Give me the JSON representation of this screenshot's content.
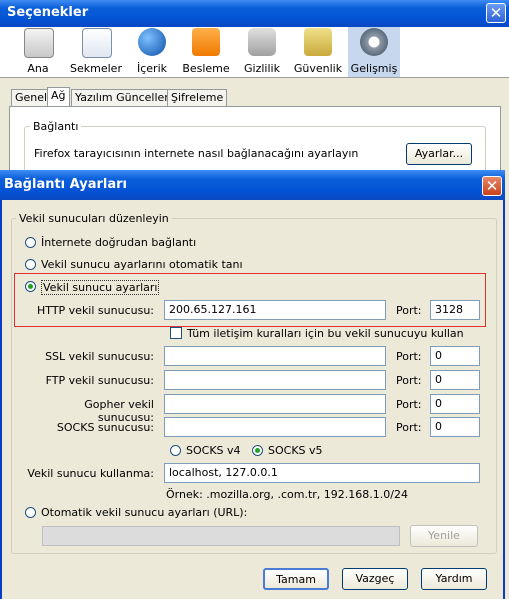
{
  "background_window": {
    "title": "Seçenekler",
    "toolbar": [
      {
        "label": "Ana",
        "icon": "main-icon"
      },
      {
        "label": "Sekmeler",
        "icon": "tabs-icon"
      },
      {
        "label": "İçerik",
        "icon": "content-globe-icon"
      },
      {
        "label": "Besleme",
        "icon": "feed-icon"
      },
      {
        "label": "Gizlilik",
        "icon": "privacy-icon"
      },
      {
        "label": "Güvenlik",
        "icon": "security-lock-icon"
      },
      {
        "label": "Gelişmiş",
        "icon": "advanced-gear-icon"
      }
    ],
    "tabs": [
      "Genel",
      "Ağ",
      "Yazılım Güncelleme",
      "Şifreleme"
    ],
    "group_label": "Bağlantı",
    "description": "Firefox tarayıcısının internete nasıl bağlanacağını ayarlayın",
    "settings_button": "Ayarlar..."
  },
  "dialog": {
    "title": "Bağlantı Ayarları",
    "group_label": "Vekil sunucuları düzenleyin",
    "options": {
      "direct": "İnternete doğrudan bağlantı",
      "auto_detect": "Vekil sunucu ayarlarını otomatik tanı",
      "manual": "Vekil sunucu ayarları",
      "auto_url": "Otomatik vekil sunucu ayarları (URL):"
    },
    "http": {
      "label": "HTTP vekil sunucusu:",
      "value": "200.65.127.161",
      "port_label": "Port:",
      "port": "3128"
    },
    "use_all": "Tüm iletişim kuralları için bu vekil sunucuyu kullan",
    "ssl": {
      "label": "SSL vekil sunucusu:",
      "value": "",
      "port_label": "Port:",
      "port": "0"
    },
    "ftp": {
      "label": "FTP vekil sunucusu:",
      "value": "",
      "port_label": "Port:",
      "port": "0"
    },
    "gopher": {
      "label": "Gopher vekil sunucusu:",
      "value": "",
      "port_label": "Port:",
      "port": "0"
    },
    "socks": {
      "label": "SOCKS sunucusu:",
      "value": "",
      "port_label": "Port:",
      "port": "0"
    },
    "socks_v4": "SOCKS v4",
    "socks_v5": "SOCKS v5",
    "no_proxy": {
      "label": "Vekil sunucu kullanma:",
      "value": "localhost, 127.0.0.1"
    },
    "example": "Örnek: .mozilla.org, .com.tr, 192.168.1.0/24",
    "reload": "Yenile",
    "buttons": {
      "ok": "Tamam",
      "cancel": "Vazgeç",
      "help": "Yardım"
    }
  }
}
